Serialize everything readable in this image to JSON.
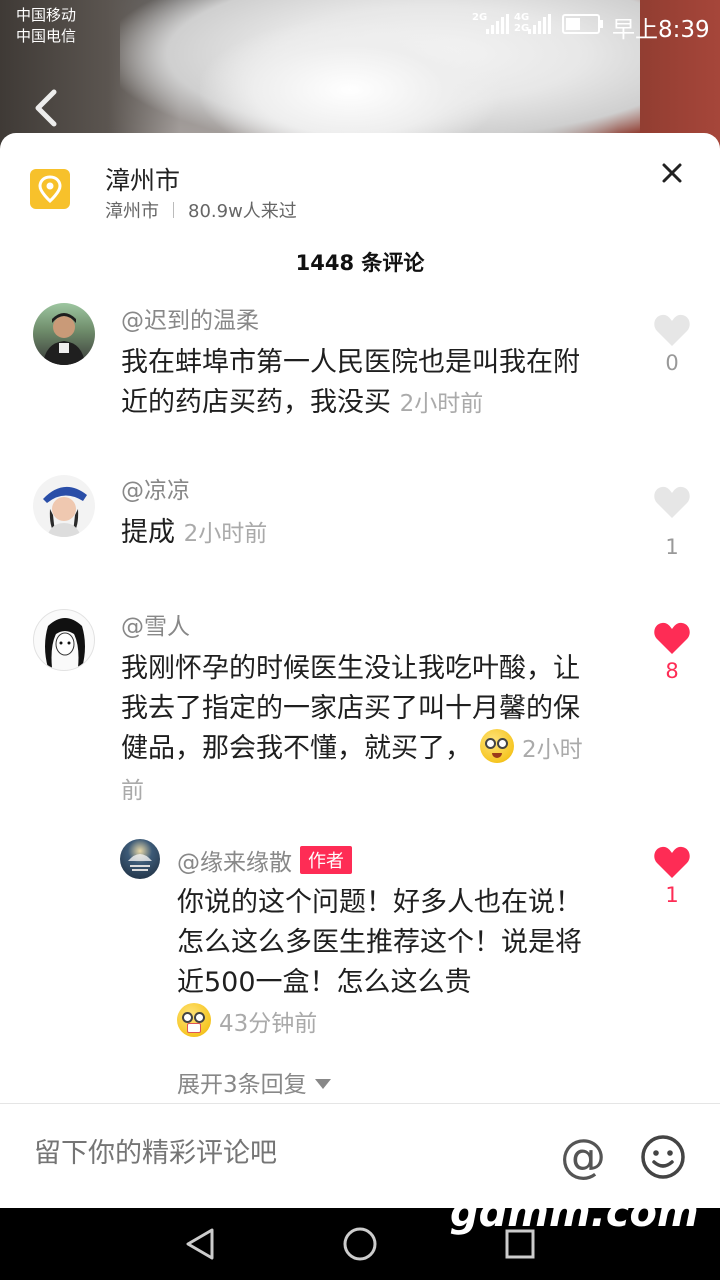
{
  "status_bar": {
    "carrier1": "中国移动",
    "carrier2": "中国电信",
    "sig1": "2G",
    "sig2": "4G 2G",
    "time": "早上8:39"
  },
  "location": {
    "title": "漳州市",
    "city": "漳州市",
    "visitors": "80.9w人来过"
  },
  "comments_header": "1448 条评论",
  "comments": [
    {
      "user": "@迟到的温柔",
      "text": "我在蚌埠市第一人民医院也是叫我在附近的药店买药，我没买",
      "time": "2小时前",
      "likes": "0",
      "liked": false
    },
    {
      "user": "@凉凉",
      "text": "提成",
      "time": "2小时前",
      "likes": "1",
      "liked": false
    },
    {
      "user": "@雪人",
      "text": "我刚怀孕的时候医生没让我吃叶酸，让我去了指定的一家店买了叫十月馨的保健品，那会我不懂，就买了，",
      "time": "2小时前",
      "likes": "8",
      "liked": true
    }
  ],
  "reply": {
    "user": "@缘来缘散",
    "tag": "作者",
    "text": "你说的这个问题！好多人也在说！怎么这么多医生推荐这个！说是将近500一盒！怎么这么贵",
    "time": "43分钟前",
    "likes": "1",
    "liked": true
  },
  "expand_label": "展开3条回复",
  "input": {
    "placeholder": "留下你的精彩评论吧"
  },
  "at_symbol": "@",
  "watermark": "gdmm.com",
  "colors": {
    "accent": "#fe2c55",
    "location_icon": "#f7c12b"
  },
  "icons": [
    "back-arrow-icon",
    "location-pin-icon",
    "close-icon",
    "heart-icon",
    "at-icon",
    "smile-icon",
    "nav-back-icon",
    "nav-home-icon",
    "nav-recent-icon"
  ]
}
